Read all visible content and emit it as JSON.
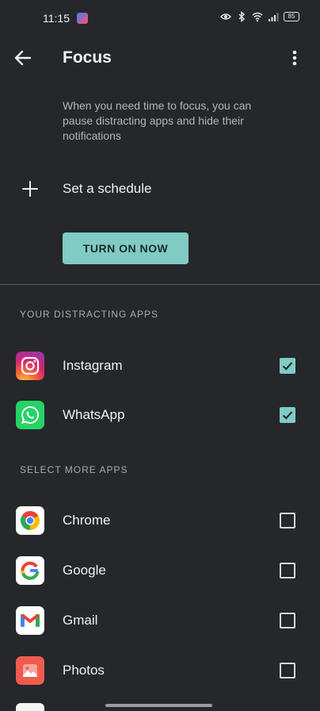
{
  "status_bar": {
    "time": "11:15",
    "battery": "85"
  },
  "header": {
    "title": "Focus"
  },
  "description": "When you need time to focus, you can pause distracting apps and hide their notifications",
  "schedule": {
    "label": "Set a schedule"
  },
  "turn_on_button": {
    "label": "TURN ON NOW"
  },
  "distracting_section": {
    "title": "YOUR DISTRACTING APPS",
    "apps": [
      {
        "name": "Instagram",
        "checked": true
      },
      {
        "name": "WhatsApp",
        "checked": true
      }
    ]
  },
  "more_section": {
    "title": "SELECT MORE APPS",
    "apps": [
      {
        "name": "Chrome",
        "checked": false
      },
      {
        "name": "Google",
        "checked": false
      },
      {
        "name": "Gmail",
        "checked": false
      },
      {
        "name": "Photos",
        "checked": false
      }
    ]
  },
  "colors": {
    "accent": "#80cbc4",
    "background": "#25272a"
  }
}
